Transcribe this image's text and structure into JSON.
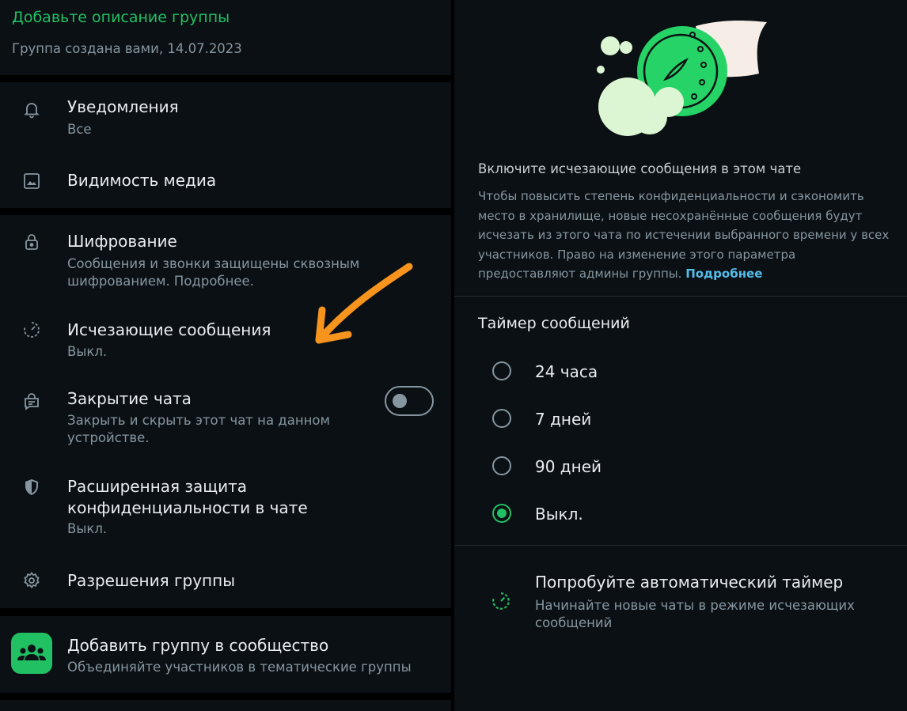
{
  "left": {
    "group_description_link": "Добавьте описание группы",
    "group_created": "Группа создана вами, 14.07.2023",
    "items": [
      {
        "title": "Уведомления",
        "subtitle": "Все",
        "icon": "bell-icon"
      },
      {
        "title": "Видимость медиа",
        "icon": "image-icon"
      },
      {
        "title": "Шифрование",
        "subtitle": "Сообщения и звонки защищены сквозным шифрованием. Подробнее.",
        "icon": "lock-icon"
      },
      {
        "title": "Исчезающие сообщения",
        "subtitle": "Выкл.",
        "icon": "timer-icon"
      },
      {
        "title": "Закрытие чата",
        "subtitle": "Закрыть и скрыть этот чат на данном устройстве.",
        "icon": "chat-lock-icon",
        "toggle_on": false
      },
      {
        "title": "Расширенная защита конфиденциальности в чате",
        "subtitle": "Выкл.",
        "icon": "shield-icon"
      },
      {
        "title": "Разрешения группы",
        "icon": "gear-icon"
      }
    ],
    "community": {
      "title": "Добавить группу в сообщество",
      "subtitle": "Объединяйте участников в тематические группы",
      "icon": "community-icon"
    },
    "annotation_arrow_color": "#f7941d"
  },
  "right": {
    "title": "Включите исчезающие сообщения в этом чате",
    "description": "Чтобы повысить степень конфиденциальности и сэкономить место в хранилище, новые несохранённые сообщения будут исчезать из этого чата по истечении выбранного времени у всех участников. Право на изменение этого параметра предоставляют админы группы.",
    "learn_more": "Подробнее",
    "timer_header": "Таймер сообщений",
    "options": [
      {
        "label": "24 часа",
        "selected": false
      },
      {
        "label": "7 дней",
        "selected": false
      },
      {
        "label": "90 дней",
        "selected": false
      },
      {
        "label": "Выкл.",
        "selected": true
      }
    ],
    "auto_timer": {
      "title": "Попробуйте автоматический таймер",
      "subtitle": "Начинайте новые чаты в режиме исчезающих сообщений",
      "icon": "timer-icon"
    }
  },
  "colors": {
    "accent": "#21c063",
    "background": "#0b1014",
    "link_blue": "#53bdeb",
    "muted_text": "#8696a0"
  }
}
